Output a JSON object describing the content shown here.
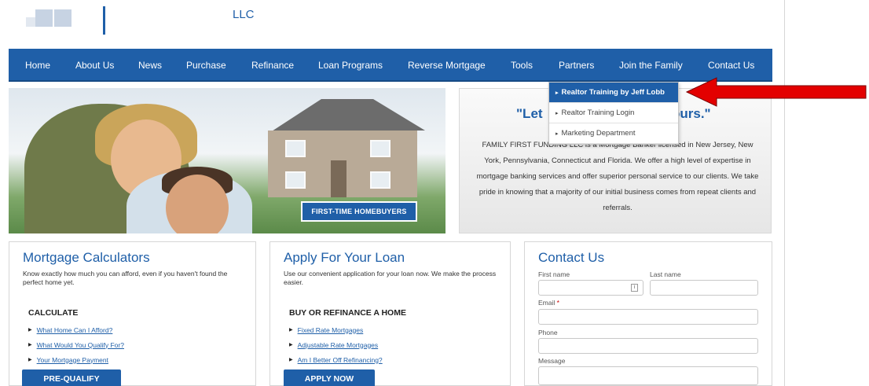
{
  "header": {
    "company_suffix": "LLC"
  },
  "nav": {
    "items": [
      {
        "label": "Home"
      },
      {
        "label": "About Us"
      },
      {
        "label": "News"
      },
      {
        "label": "Purchase"
      },
      {
        "label": "Refinance"
      },
      {
        "label": "Loan Programs"
      },
      {
        "label": "Reverse Mortgage"
      },
      {
        "label": "Tools"
      },
      {
        "label": "Partners"
      },
      {
        "label": "Join the Family"
      },
      {
        "label": "Contact Us"
      }
    ],
    "partners_dropdown": [
      {
        "label": "Realtor Training by Jeff Lobb",
        "highlighted": true
      },
      {
        "label": "Realtor Training Login"
      },
      {
        "label": "Marketing Department"
      }
    ]
  },
  "hero": {
    "badge": "FIRST-TIME HOMEBUYERS"
  },
  "intro": {
    "quote_start": "\"Let",
    "quote_end": "ours.\"",
    "text": "FAMILY FIRST FUNDING LLC is a Mortgage Banker licensed in New Jersey, New York, Pennsylvania, Connecticut and Florida.  We offer a high level of expertise in mortgage banking services and offer superior personal service to our clients.  We take pride in knowing that a majority of our initial business comes from repeat clients and referrals."
  },
  "calculators": {
    "title": "Mortgage Calculators",
    "description": "Know exactly how much you can afford, even if you haven't found the perfect home yet.",
    "subheading": "CALCULATE",
    "links": [
      "What Home Can I Afford?",
      "What Would You Qualify For?",
      "Your Mortgage Payment"
    ],
    "button": "PRE-QUALIFY"
  },
  "apply": {
    "title": "Apply For Your Loan",
    "description": "Use our convenient application for your loan now. We make the process easier.",
    "subheading": "BUY OR REFINANCE A HOME",
    "links": [
      "Fixed Rate Mortgages",
      "Adjustable Rate Mortgages",
      "Am I Better Off Refinancing?"
    ],
    "button": "APPLY NOW"
  },
  "contact": {
    "title": "Contact Us",
    "first_name_label": "First name",
    "last_name_label": "Last name",
    "email_label": "Email",
    "required_mark": "*",
    "phone_label": "Phone",
    "message_label": "Message"
  },
  "colors": {
    "brand_blue": "#1f5fa8",
    "arrow_red": "#e30000"
  }
}
